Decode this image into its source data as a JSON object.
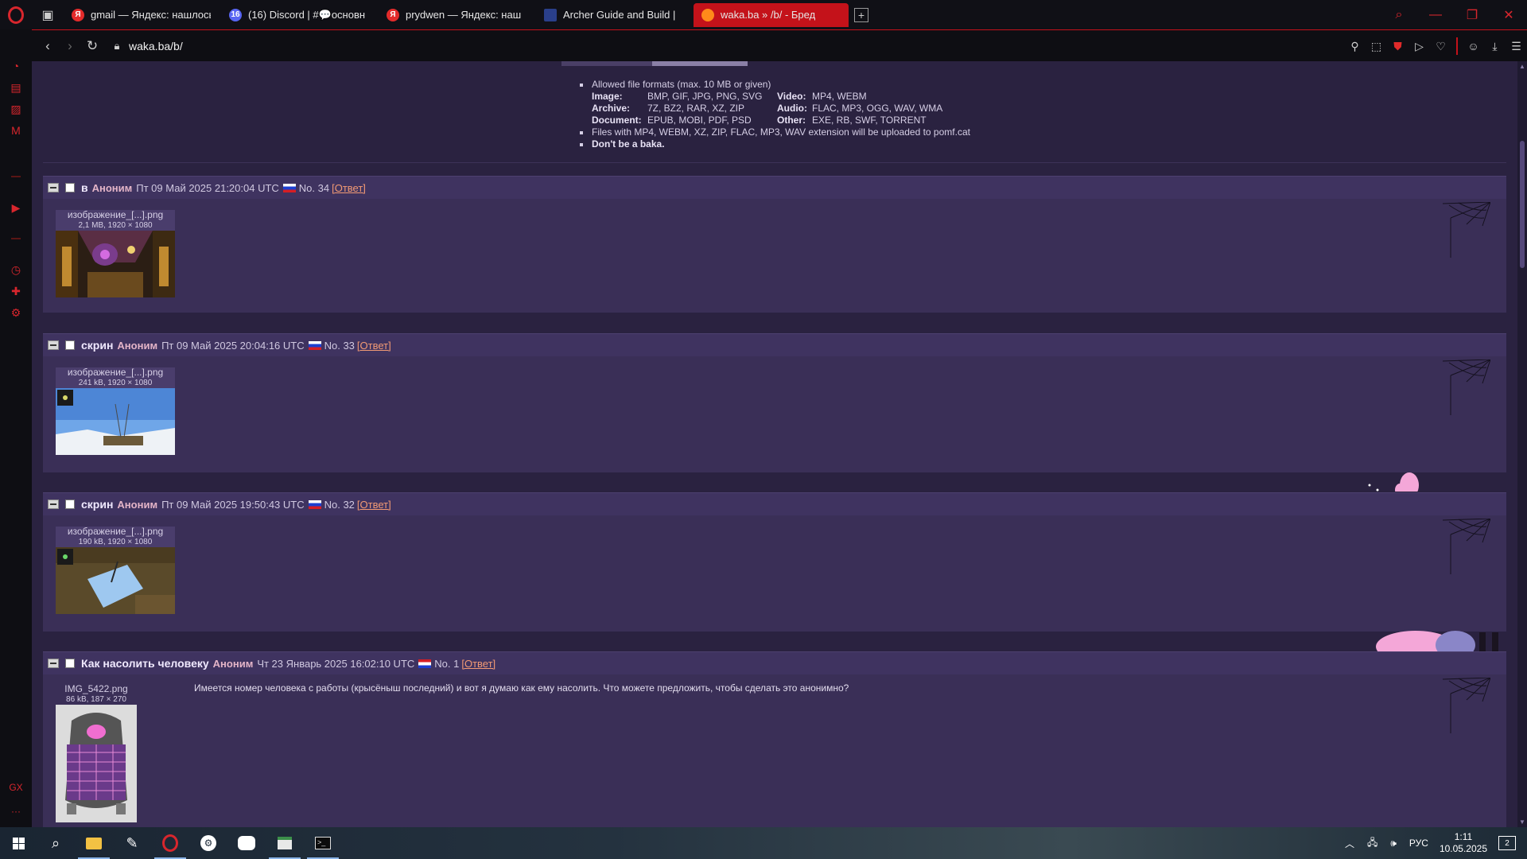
{
  "browser": {
    "tabs": [
      {
        "icon": "yandex-icon",
        "title": "gmail — Яндекс: нашлось"
      },
      {
        "icon": "discord-icon",
        "badge": "16",
        "title": "(16) Discord | #💬основн"
      },
      {
        "icon": "yandex-icon",
        "title": "prydwen — Яндекс: наш"
      },
      {
        "icon": "archer-icon",
        "title": "Archer Guide and Build | "
      },
      {
        "icon": "waka-icon",
        "title": "waka.ba » /b/ - Бред",
        "active": true
      }
    ],
    "url": "waka.ba/b/"
  },
  "rules": {
    "line1": "Allowed file formats (max. 10 MB or given)",
    "formats": [
      {
        "label": "Image:",
        "value": "BMP, GIF, JPG, PNG, SVG",
        "label2": "Video:",
        "value2": "MP4, WEBM"
      },
      {
        "label": "Archive:",
        "value": "7Z, BZ2, RAR, XZ, ZIP",
        "label2": "Audio:",
        "value2": "FLAC, MP3, OGG, WAV, WMA"
      },
      {
        "label": "Document:",
        "value": "EPUB, MOBI, PDF, PSD",
        "label2": "Other:",
        "value2": "EXE, RB, SWF, TORRENT"
      }
    ],
    "line2": "Files with MP4, WEBM, XZ, ZIP, FLAC, MP3, WAV extension will be uploaded to pomf.cat",
    "line3": "Don't be a baka."
  },
  "posts": [
    {
      "subject": "в",
      "name": "Аноним",
      "date": "Пт 09 Май 2025 21:20:04 UTC",
      "no": "No. 34",
      "reply": "[Ответ]",
      "file": "изображение_[...].png",
      "size": "2,1 MB, 1920 × 1080",
      "text": ""
    },
    {
      "subject": "скрин",
      "name": "Аноним",
      "date": "Пт 09 Май 2025 20:04:16 UTC",
      "no": "No. 33",
      "reply": "[Ответ]",
      "file": "изображение_[...].png",
      "size": "241 kB, 1920 × 1080",
      "text": ""
    },
    {
      "subject": "скрин",
      "name": "Аноним",
      "date": "Пт 09 Май 2025 19:50:43 UTC",
      "no": "No. 32",
      "reply": "[Ответ]",
      "file": "изображение_[...].png",
      "size": "190 kB, 1920 × 1080",
      "text": ""
    },
    {
      "subject": "Как насолить человеку",
      "name": "Аноним",
      "date": "Чт 23 Январь 2025 16:02:10 UTC",
      "no": "No. 1",
      "reply": "[Ответ]",
      "file": "IMG_5422.png",
      "size": "86 kB, 187 × 270",
      "text": "Имеется номер человека с работы (крысёныш последний) и вот я думаю как ему насолить. Что можете предложить, чтобы сделать это анонимно?"
    }
  ],
  "taskbar": {
    "lang": "РУС",
    "time": "1:11",
    "date": "10.05.2025",
    "notifications": "2"
  },
  "sidebar": {
    "bottom_label": "GX"
  },
  "colors": {
    "accent": "#c4121a",
    "page_bg": "#2a2240",
    "post_bg": "#3a2f57",
    "name": "#e4b5c8",
    "reply_link": "#f29a74"
  }
}
